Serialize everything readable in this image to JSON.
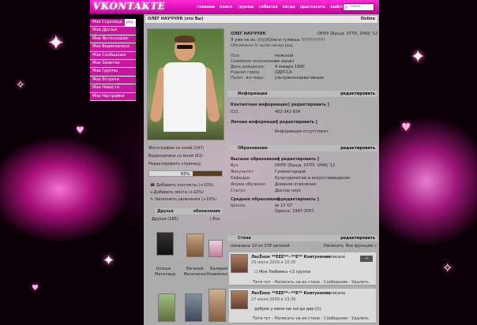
{
  "header": {
    "logo": "VKONTAKTE",
    "nav": [
      "главная",
      "поиск",
      "группы",
      "события",
      "люди",
      "пригласить",
      "выйти"
    ],
    "search_placeholder": "поиск"
  },
  "leftmenu": {
    "items": [
      {
        "label": "Моя Страница",
        "edit": "ред."
      },
      {
        "label": "Мои Друзья"
      },
      {
        "label": "Мои Фотографии"
      },
      {
        "label": "Мои Видеозаписи"
      },
      {
        "label": "Мои Сообщения"
      },
      {
        "label": "Мои Заметки"
      },
      {
        "label": "Мои Группы"
      },
      {
        "label": "Мои Встречи"
      },
      {
        "label": "Мои Новости"
      },
      {
        "label": "Мои Настройки"
      }
    ]
  },
  "profile": {
    "namebar_title": "ОЛЕГ НАУЧЧУК (это Вы)",
    "online": "Online",
    "name": "ОЛЕГ НАУЧЧУК",
    "school": "ОНПУ (Вышд. ОГПУ, ОНИ) '12",
    "status": "Я уже не из :)))))))Олеги гуляешь !!!!!!!!!!!!!!!",
    "updated": "Обновлено 9 часов назад ред.",
    "fields": [
      {
        "label": "Пол:",
        "value": "мужской"
      },
      {
        "label": "Семейное положение:",
        "value": "не женат"
      },
      {
        "label": "День рождения:",
        "value": "4 января 1990"
      },
      {
        "label": "Родной город:",
        "value": "ОДЕССА"
      },
      {
        "label": "Полит. взгляды:",
        "value": "ультраконсервативные"
      }
    ]
  },
  "under_photo": {
    "photos_with_me": "Фотографии со мной (147)",
    "videos_with_me": "Видеозаписи со мной (61)",
    "edit_page": "Редактировать страницу",
    "rating_pct": "63%",
    "rating_fraction": 0.63,
    "links": [
      "Добавить контакты (+10%)",
      "Добавить места (+10%)",
      "Заполнить увлечения (+10%)"
    ]
  },
  "info_section": {
    "title": "Информация",
    "edit": "редактировать",
    "contact_title": "Контактная информация",
    "contact_edit": "[ редактировать ]",
    "icq_label": "ICQ:",
    "icq_value": "402-342-834",
    "personal_title": "Личная информация",
    "personal_edit": "[ редактировать ]",
    "personal_missing": "Информация отсутствует."
  },
  "education": {
    "title": "Образование",
    "edit": "редактировать",
    "higher_title": "Высшее образование",
    "higher_edit": "[ редактировать ]",
    "fields": [
      {
        "label": "Вуз:",
        "value": "ОНПУ (Вышд. ОГПУ, ОНИ) '12"
      },
      {
        "label": "Факультет:",
        "value": "Гуманитарный"
      },
      {
        "label": "Кафедра:",
        "value": "Культурологии и искусствоведения"
      },
      {
        "label": "Форма обучения:",
        "value": "Дневное отделение"
      },
      {
        "label": "Статус:",
        "value": "Доктор наук"
      }
    ],
    "secondary_title": "Среднее образование",
    "secondary_edit": "[ редактировать ]",
    "school_label": "Школа:",
    "school_value": "№ 13 '07",
    "school_city": "Одесса, 1997-2007"
  },
  "friends": {
    "title": "Друзья",
    "updates": "обновления",
    "count": "Друзья (165)",
    "all": "| Все",
    "names": [
      {
        "first": "Ксюша",
        "last": "Метелица"
      },
      {
        "first": "Евгений",
        "last": "Василенко"
      },
      {
        "first": "Валерия",
        "last": "Клименко"
      }
    ]
  },
  "wall": {
    "title": "Стена",
    "edit": "редактировать",
    "showing": "показаны 10 из 378 записей",
    "write": "Написать",
    "all_posts": "Все функции »",
    "posts": [
      {
        "author": "ЛесЁнок **ЕЕЕ**~**Е** Ковтуненко",
        "action": "написала",
        "date": "29 июля 2009 в 16:25",
        "text": "Моя Любимка <3 группа",
        "actions": "Тетя-тет - Написать на ее стене - Сообщение - Удалить",
        "btn": "→"
      },
      {
        "author": "ЛесЁнок **ЕЕЕ**~**Е** Ковтуненко",
        "action": "написала",
        "date": "27 июля 2009 в 19:36",
        "text": "доброе у меня ню когда два:))))",
        "actions": "Тетя-тет - Написать на ее стене - Сообщение - Удалить"
      }
    ]
  },
  "colors": {
    "accent": "#c8179f",
    "header": "#ff2bd6",
    "background": "#0a0006"
  }
}
